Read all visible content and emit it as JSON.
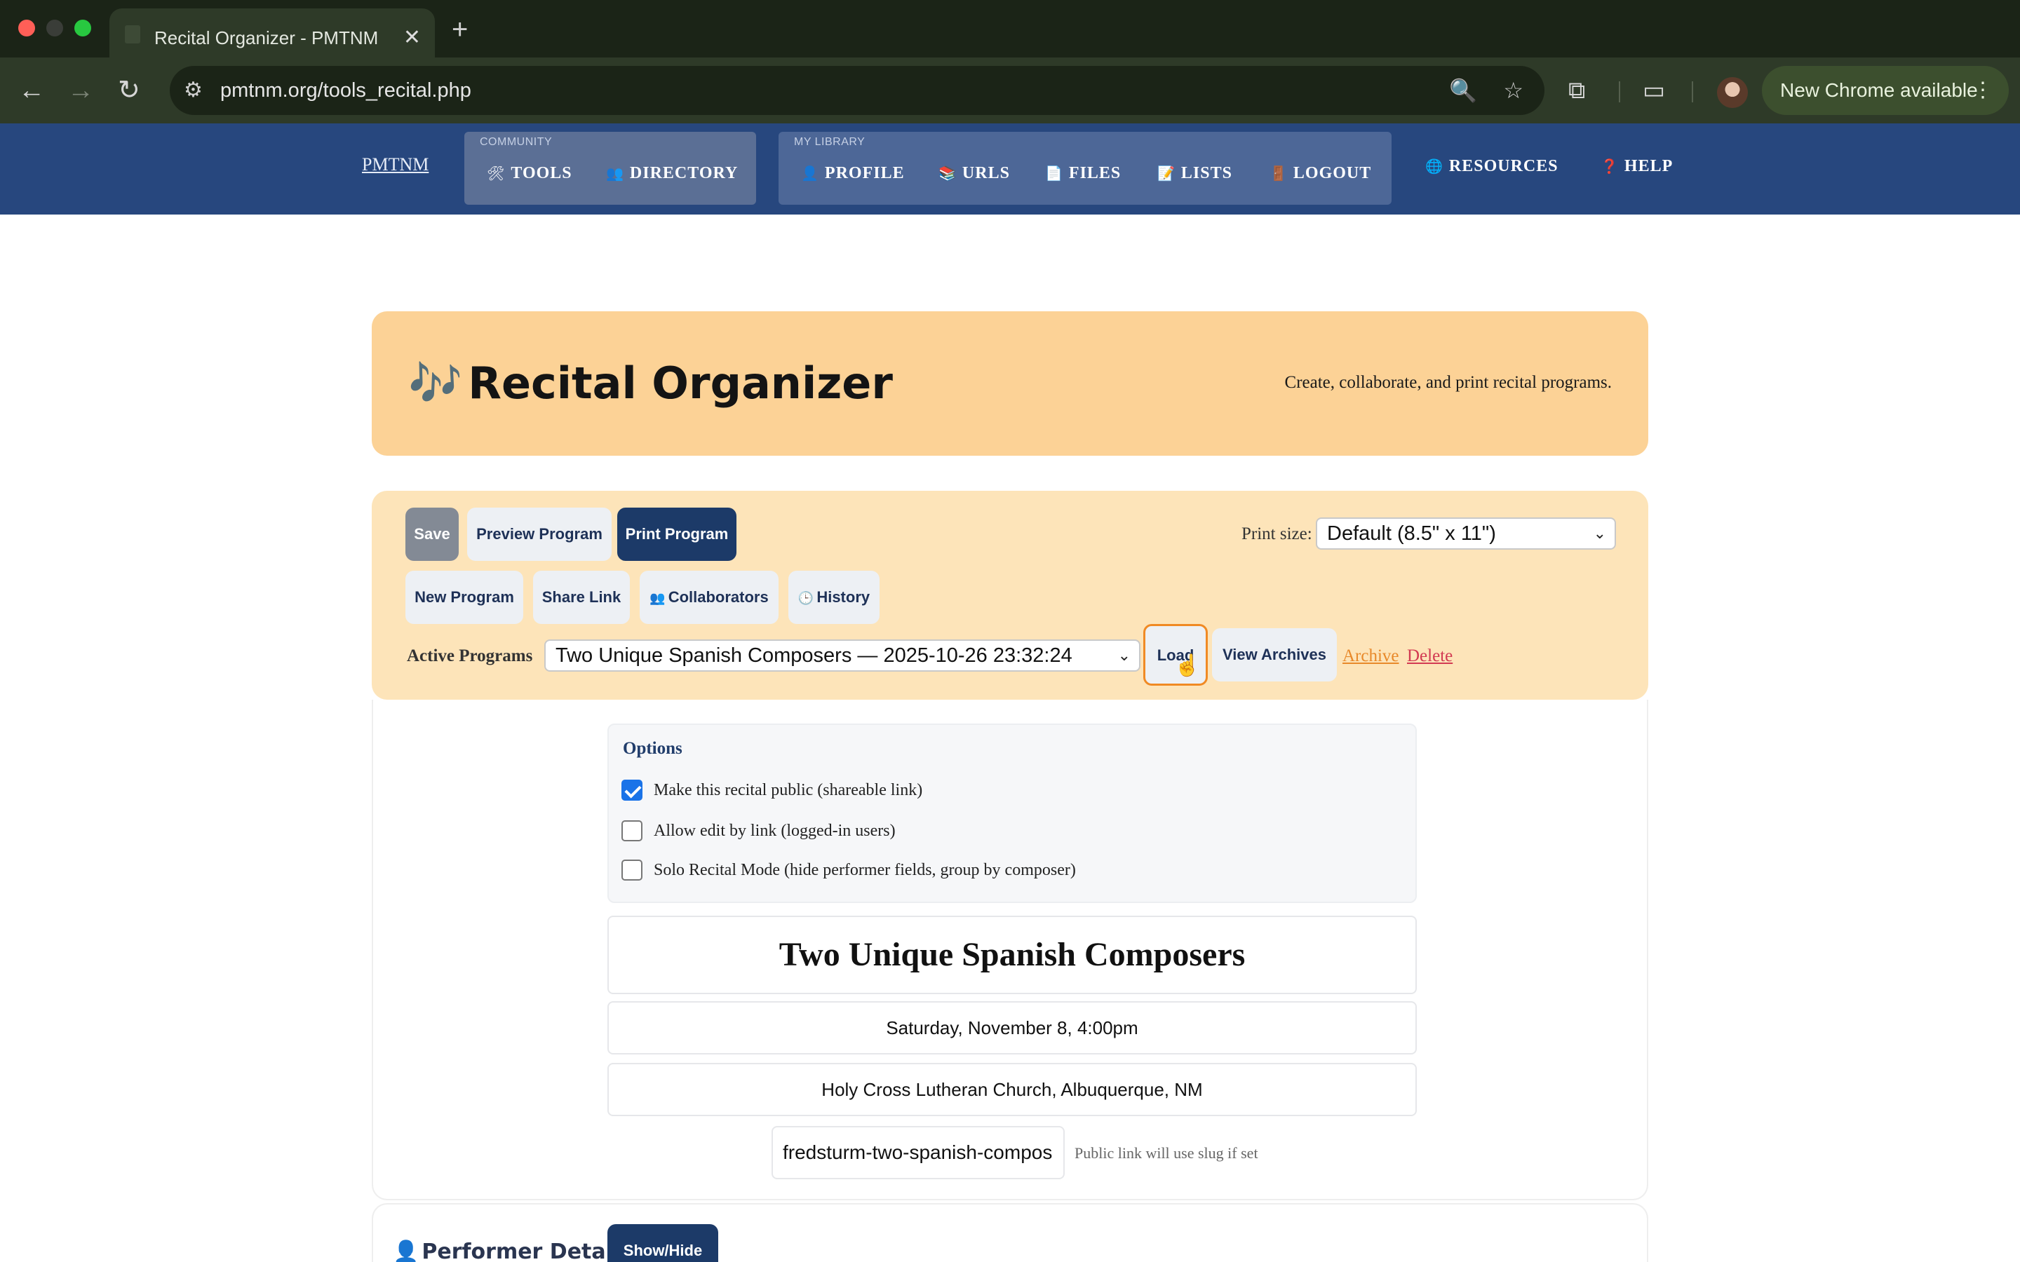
{
  "browser": {
    "tab_title": "Recital Organizer - PMTNM",
    "tab_close": "✕",
    "new_tab": "+",
    "url": "pmtnm.org/tools_recital.php",
    "update_text": "New Chrome available",
    "icons": {
      "back": "←",
      "forward": "→",
      "reload": "↻",
      "site_info": "⚙",
      "zoom": "🔍",
      "star": "☆",
      "extensions": "⧉",
      "cast": "▭",
      "menu": "⋮"
    }
  },
  "site_nav": {
    "logo": "PMTNM",
    "community_label": "COMMUNITY",
    "library_label": "MY LIBRARY",
    "items": [
      {
        "icon": "🛠",
        "label": "TOOLS"
      },
      {
        "icon": "👥",
        "label": "DIRECTORY"
      },
      {
        "icon": "👤",
        "label": "PROFILE"
      },
      {
        "icon": "📚",
        "label": "URLS"
      },
      {
        "icon": "📄",
        "label": "FILES"
      },
      {
        "icon": "📝",
        "label": "LISTS"
      },
      {
        "icon": "🚪",
        "label": "LOGOUT"
      },
      {
        "icon": "🌐",
        "label": "RESOURCES"
      },
      {
        "icon": "❓",
        "label": "HELP"
      }
    ]
  },
  "banner": {
    "icon": "🎶",
    "title": "Recital Organizer",
    "tagline": "Create, collaborate, and print recital programs."
  },
  "controls": {
    "save": "Save",
    "preview": "Preview Program",
    "print": "Print Program",
    "new_program": "New Program",
    "share_link": "Share Link",
    "collaborators_icon": "👥",
    "collaborators": "Collaborators",
    "history_icon": "🕒",
    "history": "History",
    "print_size_label": "Print size:",
    "print_size_value": "Default (8.5\" x 11\")",
    "active_programs_label": "Active Programs",
    "active_program_value": "Two Unique Spanish Composers — 2025-10-26 23:32:24",
    "load": "Load",
    "view_archives": "View Archives",
    "archive": "Archive",
    "delete": "Delete"
  },
  "options": {
    "title": "Options",
    "items": [
      {
        "label": "Make this recital public (shareable link)",
        "checked": true
      },
      {
        "label": "Allow edit by link (logged-in users)",
        "checked": false
      },
      {
        "label": "Solo Recital Mode (hide performer fields, group by composer)",
        "checked": false
      }
    ]
  },
  "program": {
    "title": "Two Unique Spanish Composers",
    "date": "Saturday, November 8, 4:00pm",
    "venue": "Holy Cross Lutheran Church, Albuquerque, NM",
    "slug": "fredsturm-two-spanish-compos",
    "slug_hint": "Public link will use slug if set"
  },
  "performer": {
    "icon": "👤",
    "title": "Performer Details",
    "toggle": "Show/Hide"
  },
  "colors": {
    "header_bg": "#27477e",
    "banner_bg": "#fcd296",
    "controls_bg": "#fde4b9",
    "primary_button": "#1c3a68",
    "load_focus": "#f08a24",
    "archive_link": "#e8892a",
    "delete_link": "#d23a52"
  }
}
